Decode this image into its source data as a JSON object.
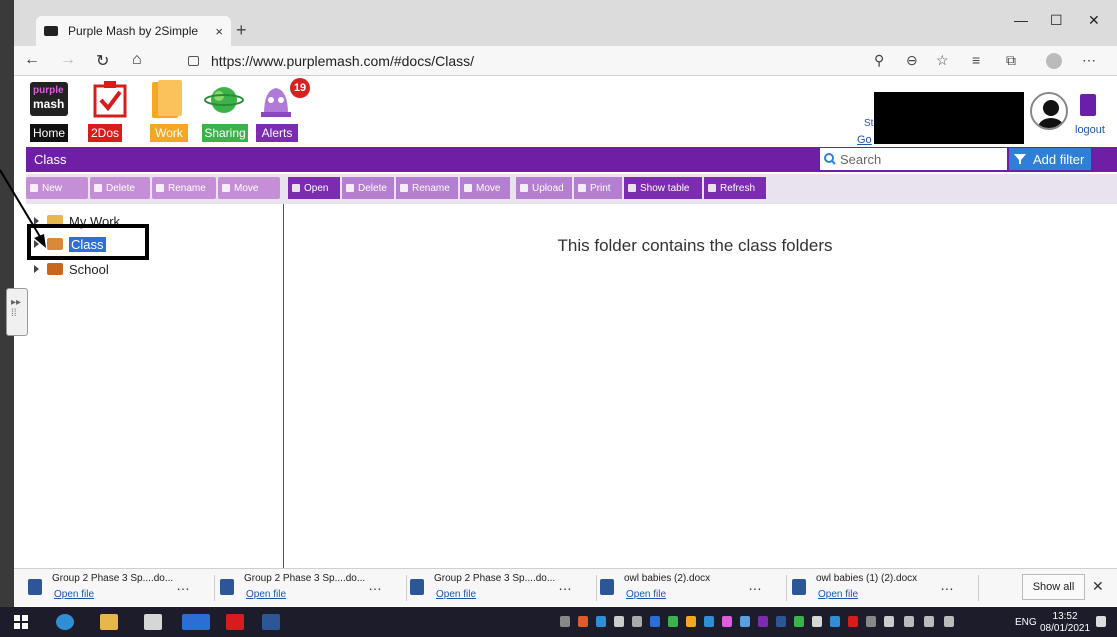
{
  "browser": {
    "tab_title": "Purple Mash by 2Simple",
    "url": "https://www.purplemash.com/#docs/Class/"
  },
  "purplemash": {
    "logo_top": "purple",
    "logo_bottom": "mash",
    "nav": [
      "Home",
      "2Dos",
      "Work",
      "Sharing",
      "Alerts"
    ],
    "alerts_count": "19",
    "user_partial": "St",
    "user_link": "Go",
    "logout_label": "logout",
    "page_title": "Class",
    "search_placeholder": "Search",
    "add_filter_label": "Add filter",
    "left_toolbar": [
      "New",
      "Delete",
      "Rename",
      "Move"
    ],
    "right_toolbar": [
      "Open",
      "Delete",
      "Rename",
      "Move",
      "Upload",
      "Print",
      "Show table",
      "Refresh"
    ],
    "tree": [
      "My Work",
      "Class",
      "School"
    ],
    "folder_message": "This folder contains the class folders"
  },
  "downloads": {
    "items": [
      {
        "name": "Group 2 Phase 3 Sp....do...",
        "action": "Open file"
      },
      {
        "name": "Group 2 Phase 3 Sp....do...",
        "action": "Open file"
      },
      {
        "name": "Group 2 Phase 3 Sp....do...",
        "action": "Open file"
      },
      {
        "name": "owl babies (2).docx",
        "action": "Open file"
      },
      {
        "name": "owl babies (1) (2).docx",
        "action": "Open file"
      }
    ],
    "show_all": "Show all"
  },
  "taskbar": {
    "language": "ENG",
    "time": "13:52",
    "date": "08/01/2021"
  },
  "colors": {
    "purple": "#6e1fa6",
    "home": "#111111",
    "todos": "#d81c1c",
    "work": "#f5a623",
    "sharing": "#3bb24a",
    "alerts": "#7b2cb0",
    "filter_blue": "#2f7fd6"
  }
}
